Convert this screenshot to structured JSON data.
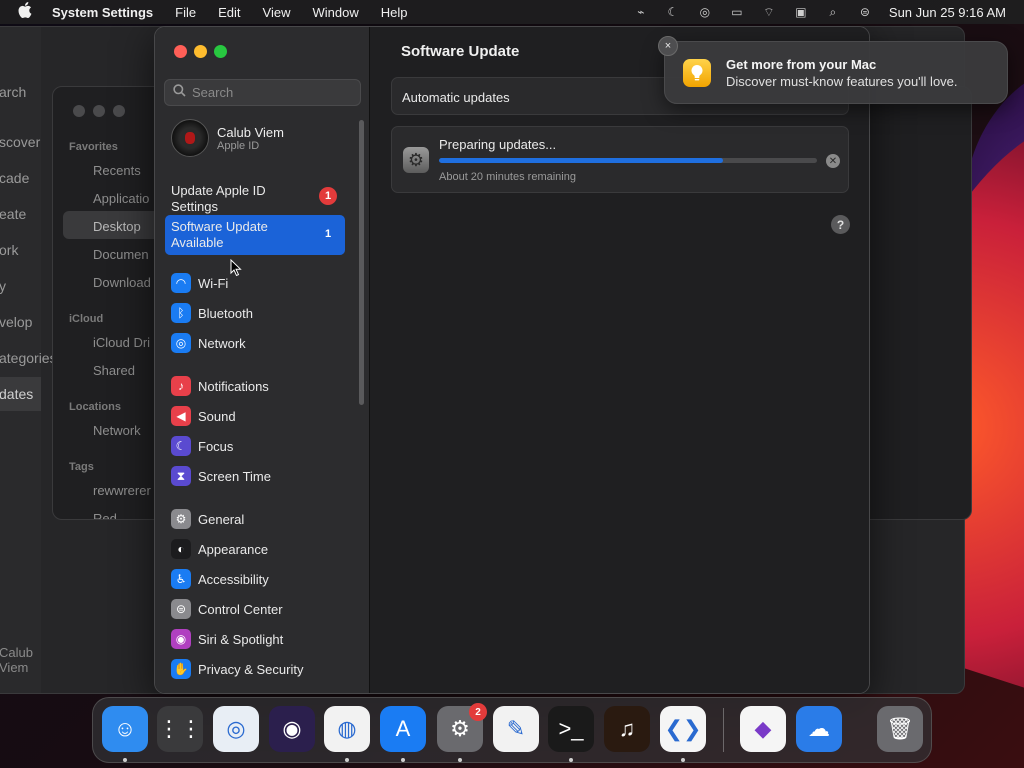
{
  "menubar": {
    "app_name": "System Settings",
    "menus": [
      "File",
      "Edit",
      "View",
      "Window",
      "Help"
    ],
    "datetime": "Sun Jun 25  9:16 AM"
  },
  "background_finder": {
    "sidebar_fragments": [
      "arch",
      "scover",
      "cade",
      "eate",
      "ork",
      "y",
      "velop",
      "ategories",
      "dates"
    ],
    "user_fragment": "Calub Viem",
    "sections": {
      "favorites": "Favorites",
      "icloud": "iCloud",
      "locations": "Locations",
      "tags": "Tags"
    },
    "items": [
      "Recents",
      "Applicatio",
      "Desktop",
      "Documen",
      "Download",
      "iCloud Dri",
      "Shared",
      "Network",
      "rewwrerer",
      "Red"
    ]
  },
  "settings": {
    "search_placeholder": "Search",
    "user": {
      "name": "Calub Viem",
      "subtitle": "Apple ID"
    },
    "pending": [
      {
        "label": "Update Apple ID Settings",
        "badge": "1"
      },
      {
        "label": "Software Update Available",
        "badge": "1"
      }
    ],
    "groups": [
      [
        {
          "label": "Wi-Fi",
          "icon": "wifi-icon",
          "color": "#1a7cf3"
        },
        {
          "label": "Bluetooth",
          "icon": "bluetooth-icon",
          "color": "#1a7cf3"
        },
        {
          "label": "Network",
          "icon": "globe-icon",
          "color": "#1a7cf3"
        }
      ],
      [
        {
          "label": "Notifications",
          "icon": "bell-icon",
          "color": "#e8404a"
        },
        {
          "label": "Sound",
          "icon": "speaker-icon",
          "color": "#e8404a"
        },
        {
          "label": "Focus",
          "icon": "moon-icon",
          "color": "#5a4ad0"
        },
        {
          "label": "Screen Time",
          "icon": "hourglass-icon",
          "color": "#5a4ad0"
        }
      ],
      [
        {
          "label": "General",
          "icon": "gear-icon",
          "color": "#8a8a8e"
        },
        {
          "label": "Appearance",
          "icon": "appearance-icon",
          "color": "#1c1c1e"
        },
        {
          "label": "Accessibility",
          "icon": "accessibility-icon",
          "color": "#1a7cf3"
        },
        {
          "label": "Control Center",
          "icon": "toggles-icon",
          "color": "#8a8a8e"
        },
        {
          "label": "Siri & Spotlight",
          "icon": "siri-icon",
          "color": "#b040c0"
        },
        {
          "label": "Privacy & Security",
          "icon": "hand-icon",
          "color": "#1a7cf3"
        }
      ]
    ],
    "main": {
      "title": "Software Update",
      "automatic_updates": "Automatic updates",
      "status": "Preparing updates...",
      "remaining": "About 20 minutes remaining",
      "progress": 0.75,
      "help": "?"
    }
  },
  "notification": {
    "title": "Get more from your Mac",
    "body": "Discover must-know features you'll love.",
    "close": "×"
  },
  "dock": {
    "apps": [
      {
        "name": "finder-icon",
        "color": "#2f8cf0",
        "running": true
      },
      {
        "name": "launchpad-icon",
        "color": "#3a3a3c",
        "running": false
      },
      {
        "name": "safari-icon",
        "color": "#e8eef5",
        "running": false
      },
      {
        "name": "firefox-icon",
        "color": "#2b1f4d",
        "running": false
      },
      {
        "name": "chrome-icon",
        "color": "#f2f2f2",
        "running": true
      },
      {
        "name": "app-store-icon",
        "color": "#1a7cf3",
        "running": true
      },
      {
        "name": "system-settings-icon",
        "color": "#6a6a6e",
        "running": true,
        "badge": "2"
      },
      {
        "name": "textedit-icon",
        "color": "#f2f2f2",
        "running": false
      },
      {
        "name": "terminal-icon",
        "color": "#1a1a1a",
        "running": true
      },
      {
        "name": "garageband-icon",
        "color": "#2a1a10",
        "running": false
      },
      {
        "name": "vscode-icon",
        "color": "#f5f5f5",
        "running": true
      },
      {
        "name": "visual-studio-icon",
        "color": "#f5f5f5",
        "running": false
      },
      {
        "name": "weather-icon",
        "color": "#2a7ce8",
        "running": false
      },
      {
        "name": "trash-icon",
        "color": "#6a6a6e",
        "running": false
      }
    ]
  }
}
